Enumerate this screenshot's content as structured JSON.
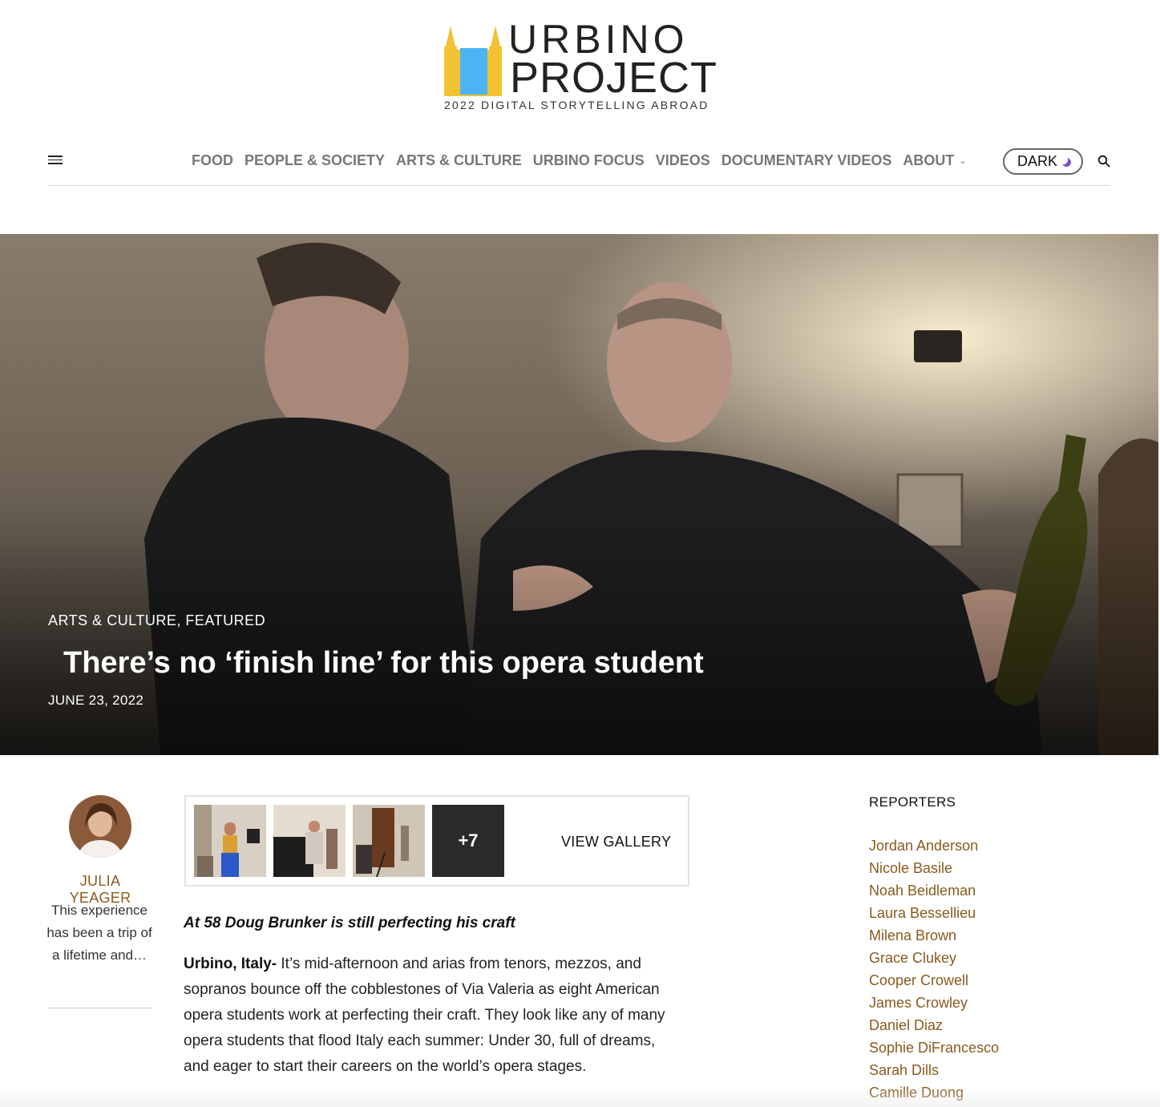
{
  "logo": {
    "word1": "URBINO",
    "word2": "PROJECT",
    "tagline": "2022 DIGITAL STORYTELLING ABROAD",
    "colors": {
      "yellow": "#f3c232",
      "blue": "#4cb3f5"
    }
  },
  "nav": {
    "items": [
      {
        "label": "FOOD"
      },
      {
        "label": "PEOPLE & SOCIETY"
      },
      {
        "label": "ARTS & CULTURE"
      },
      {
        "label": "URBINO FOCUS"
      },
      {
        "label": "VIDEOS"
      },
      {
        "label": "DOCUMENTARY VIDEOS"
      },
      {
        "label": "ABOUT"
      }
    ],
    "dark_toggle_label": "DARK",
    "menu_icon": "hamburger-icon",
    "search_icon": "search-icon"
  },
  "hero": {
    "category1": "ARTS & CULTURE",
    "category_sep": ",",
    "category2": "FEATURED",
    "title": "There’s no ‘finish line’ for this opera student",
    "date": "JUNE 23, 2022"
  },
  "author": {
    "name": "JULIA YEAGER",
    "bio": "This experience has been a trip of a lifetime and…"
  },
  "gallery": {
    "more_count": "+7",
    "view_label": "VIEW GALLERY"
  },
  "article": {
    "lede": "At 58 Doug Brunker is still perfecting his craft",
    "dateline": "Urbino, Italy-",
    "paragraph": " It’s mid-afternoon and arias from tenors, mezzos, and sopranos bounce off the cobblestones of Via Valeria as eight American opera students work at perfecting their craft. They look like any of many opera students that flood Italy each summer: Under 30, full of dreams, and eager to start their careers on the world’s opera stages."
  },
  "sidebar": {
    "heading": "REPORTERS",
    "reporters": [
      "Jordan Anderson",
      "Nicole Basile",
      "Noah Beidleman",
      "Laura Bessellieu",
      "Milena Brown",
      "Grace Clukey",
      "Cooper Crowell",
      "James Crowley",
      "Daniel Diaz",
      "Sophie DiFrancesco",
      "Sarah Dills",
      "Camille Duong"
    ]
  },
  "colors": {
    "link_brown": "#8a5a1c",
    "nav_gray": "#777777",
    "moon_purple": "#7a4fd8"
  }
}
